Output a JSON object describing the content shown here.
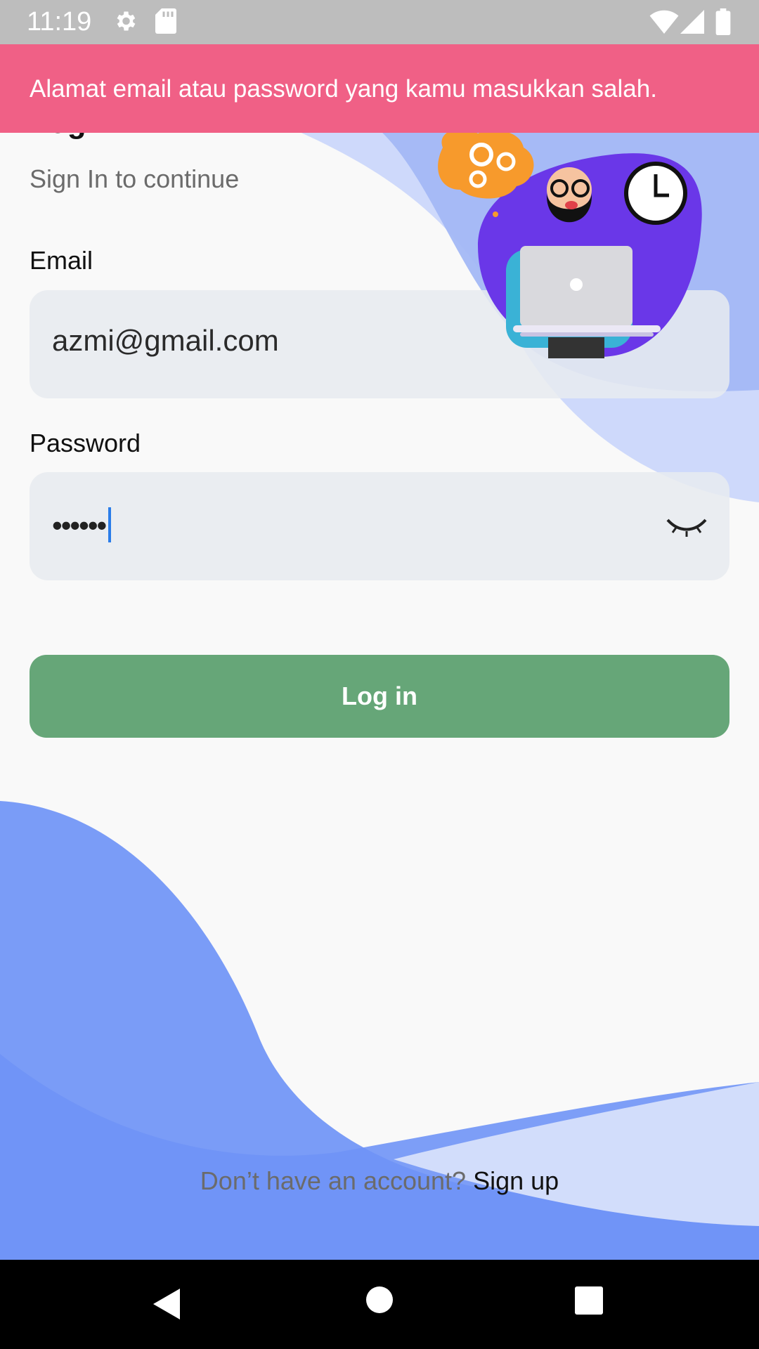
{
  "status_bar": {
    "time": "11:19",
    "icons": [
      "gear-icon",
      "sd-card-icon",
      "wifi-icon",
      "signal-icon",
      "battery-icon"
    ]
  },
  "snackbar": {
    "message": "Alamat email atau password yang kamu masukkan salah.",
    "color": "#f06086"
  },
  "header": {
    "title": "Log In",
    "subtitle": "Sign In to continue"
  },
  "form": {
    "email_label": "Email",
    "email_value": "azmi@gmail.com",
    "password_label": "Password",
    "password_value": "••••••",
    "password_toggle_icon": "eye-closed-icon"
  },
  "login_button": {
    "label": "Log in",
    "color": "#66a678"
  },
  "footer": {
    "prompt": "Don’t have an account?",
    "signup_label": "Sign up"
  },
  "nav_bar": {
    "icons": [
      "back-icon",
      "home-icon",
      "recents-icon"
    ]
  }
}
